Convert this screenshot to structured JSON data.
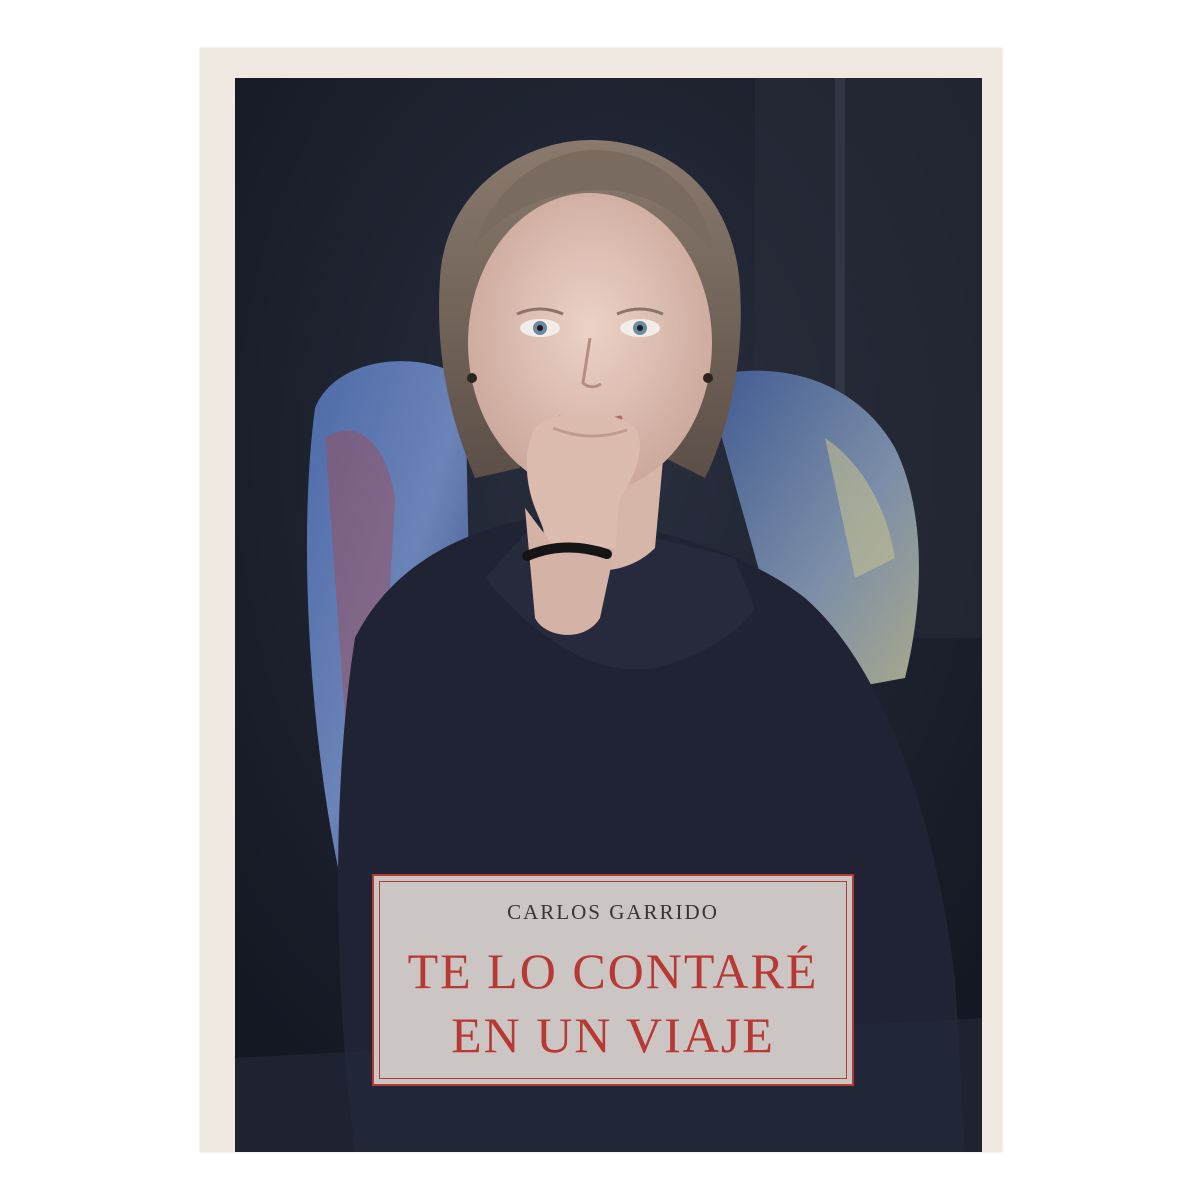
{
  "book_cover": {
    "author": "CARLOS GARRIDO",
    "title_line_1": "TE LO CONTARÉ",
    "title_line_2": "EN UN VIAJE"
  },
  "colors": {
    "cover_paper": "#efe9e1",
    "photo_background": "#1c2130",
    "label_background": "#cbc6c3",
    "label_border": "#b43a35",
    "title_text": "#b83833",
    "author_text": "#3a3434"
  }
}
